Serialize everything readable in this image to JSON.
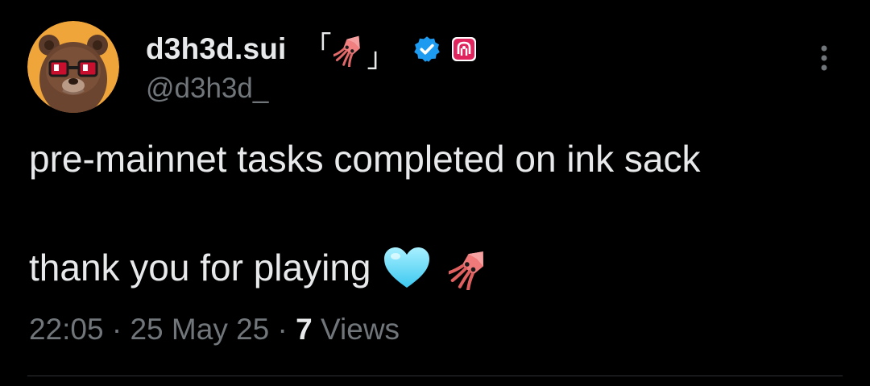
{
  "author": {
    "display_name": "d3h3d.sui",
    "name_decoration_open": "「",
    "name_decoration_close": "」",
    "name_decoration_icon": "squid-icon",
    "handle": "@d3h3d_",
    "verified_icon": "verified-badge-icon",
    "affiliate_icon": "affiliate-badge-icon",
    "avatar_icon": "bear-avatar-icon"
  },
  "menu": {
    "more_icon": "more-vertical-icon"
  },
  "tweet": {
    "line1": "pre-mainnet tasks completed on ink sack",
    "line2": "thank you for playing",
    "emojis": [
      "light-blue-heart-icon",
      "squid-icon"
    ]
  },
  "meta": {
    "time": "22:05",
    "sep1": " · ",
    "date": "25 May 25",
    "sep2": " · ",
    "views_count": "7",
    "views_label": "Views"
  },
  "colors": {
    "background": "#000000",
    "primary_text": "#e7e9ea",
    "secondary_text": "#71767b",
    "verified": "#1d9bf0",
    "affiliate": "#e0245e",
    "divider": "#2f3336"
  }
}
